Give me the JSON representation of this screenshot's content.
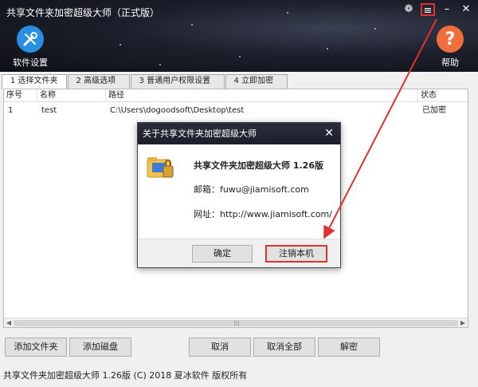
{
  "window": {
    "title": "共享文件夹加密超级大师（正式版）",
    "controls": {
      "skin": "❁",
      "menu": "≡",
      "minimize": "–",
      "close": "✕"
    }
  },
  "header": {
    "settings_label": "软件设置",
    "help_label": "帮助",
    "help_glyph": "?"
  },
  "tabs": [
    {
      "label": "1 选择文件夹"
    },
    {
      "label": "2 高级选项"
    },
    {
      "label": "3 普通用户权限设置"
    },
    {
      "label": "4 立即加密"
    }
  ],
  "table": {
    "columns": [
      "序号",
      "名称",
      "路径",
      "状态"
    ],
    "rows": [
      {
        "index": "1",
        "name": "test",
        "path": "C:\\Users\\dogoodsoft\\Desktop\\test",
        "status": "已加密"
      }
    ],
    "scroll_left": "◀",
    "scroll_right": "▶",
    "scroll_grip": "|||"
  },
  "buttons": {
    "add_folder": "添加文件夹",
    "add_disk": "添加磁盘",
    "cancel": "取消",
    "cancel_all": "取消全部",
    "decrypt": "解密"
  },
  "status_bar": "共享文件夹加密超级大师 1.26版 (C) 2018 夏冰软件 版权所有",
  "dialog": {
    "title": "关于共享文件夹加密超级大师",
    "close": "✕",
    "product": "共享文件夹加密超级大师 1.26版",
    "email": "邮箱：fuwu@jiamisoft.com",
    "website": "网址：http://www.jiamisoft.com/",
    "ok_label": "确定",
    "unregister_label": "注销本机"
  },
  "colors": {
    "highlight": "#e03030",
    "settings_icon_bg": "#2a8fe0",
    "help_icon_bg": "#f06e3c"
  }
}
